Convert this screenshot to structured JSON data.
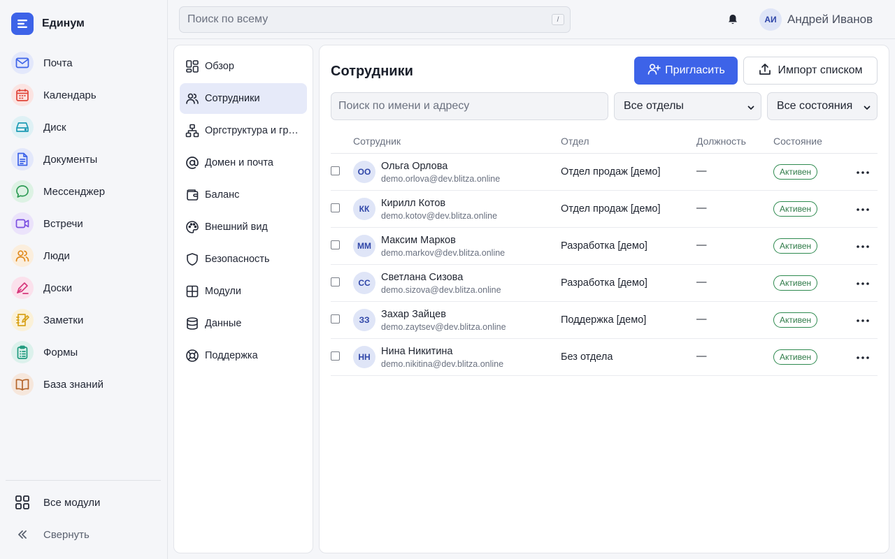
{
  "brand": {
    "name": "Единум"
  },
  "apps": [
    {
      "key": "mail",
      "label": "Почта",
      "icon": "mail-icon",
      "color": "#3d63e8",
      "bg": "#e3e8fb"
    },
    {
      "key": "calendar",
      "label": "Календарь",
      "icon": "calendar-icon",
      "color": "#e0453a",
      "bg": "#fbe4e2"
    },
    {
      "key": "disk",
      "label": "Диск",
      "icon": "drive-icon",
      "color": "#1e9bb5",
      "bg": "#dff1f5"
    },
    {
      "key": "docs",
      "label": "Документы",
      "icon": "document-icon",
      "color": "#3d63e8",
      "bg": "#e3e8fb"
    },
    {
      "key": "messenger",
      "label": "Мессенджер",
      "icon": "chat-icon",
      "color": "#2e9b55",
      "bg": "#ddf2e4"
    },
    {
      "key": "meetings",
      "label": "Встречи",
      "icon": "video-icon",
      "color": "#7b4fe0",
      "bg": "#ebe3fb"
    },
    {
      "key": "people",
      "label": "Люди",
      "icon": "people-icon",
      "color": "#e08a1e",
      "bg": "#fbeedd"
    },
    {
      "key": "boards",
      "label": "Доски",
      "icon": "pen-icon",
      "color": "#d6387c",
      "bg": "#fbe1ec"
    },
    {
      "key": "notes",
      "label": "Заметки",
      "icon": "note-icon",
      "color": "#d8a21a",
      "bg": "#fbf1d8"
    },
    {
      "key": "forms",
      "label": "Формы",
      "icon": "clipboard-icon",
      "color": "#1f9a7e",
      "bg": "#dcf1ec"
    },
    {
      "key": "kb",
      "label": "База знаний",
      "icon": "book-icon",
      "color": "#b5652a",
      "bg": "#f6e7dc"
    }
  ],
  "sidebar_bottom": {
    "all_modules": "Все модули",
    "collapse": "Свернуть"
  },
  "topbar": {
    "search_placeholder": "Поиск по всему",
    "search_shortcut": "/",
    "user_initials": "АИ",
    "user_name": "Андрей Иванов"
  },
  "settings_nav": [
    {
      "label": "Обзор",
      "icon": "overview-icon",
      "active": false
    },
    {
      "label": "Сотрудники",
      "icon": "users-icon",
      "active": true
    },
    {
      "label": "Оргструктура и группы",
      "icon": "org-structure-icon",
      "active": false
    },
    {
      "label": "Домен и почта",
      "icon": "at-icon",
      "active": false
    },
    {
      "label": "Баланс",
      "icon": "wallet-icon",
      "active": false
    },
    {
      "label": "Внешний вид",
      "icon": "palette-icon",
      "active": false
    },
    {
      "label": "Безопасность",
      "icon": "shield-icon",
      "active": false
    },
    {
      "label": "Модули",
      "icon": "modules-icon",
      "active": false
    },
    {
      "label": "Данные",
      "icon": "database-icon",
      "active": false
    },
    {
      "label": "Поддержка",
      "icon": "lifebuoy-icon",
      "active": false
    }
  ],
  "main": {
    "title": "Сотрудники",
    "invite_label": "Пригласить",
    "import_label": "Импорт списком",
    "filter_placeholder": "Поиск по имени и адресу",
    "dept_select": "Все отделы",
    "state_select": "Все состояния",
    "columns": {
      "employee": "Сотрудник",
      "dept": "Отдел",
      "position": "Должность",
      "state": "Состояние"
    },
    "rows": [
      {
        "initials": "ОО",
        "name": "Ольга Орлова",
        "email": "demo.orlova@dev.blitza.online",
        "dept": "Отдел продаж [демо]",
        "position": "—",
        "status": "Активен"
      },
      {
        "initials": "КК",
        "name": "Кирилл Котов",
        "email": "demo.kotov@dev.blitza.online",
        "dept": "Отдел продаж [демо]",
        "position": "—",
        "status": "Активен"
      },
      {
        "initials": "ММ",
        "name": "Максим Марков",
        "email": "demo.markov@dev.blitza.online",
        "dept": "Разработка [демо]",
        "position": "—",
        "status": "Активен"
      },
      {
        "initials": "СС",
        "name": "Светлана Сизова",
        "email": "demo.sizova@dev.blitza.online",
        "dept": "Разработка [демо]",
        "position": "—",
        "status": "Активен"
      },
      {
        "initials": "ЗЗ",
        "name": "Захар Зайцев",
        "email": "demo.zaytsev@dev.blitza.online",
        "dept": "Поддержка [демо]",
        "position": "—",
        "status": "Активен"
      },
      {
        "initials": "НН",
        "name": "Нина Никитина",
        "email": "demo.nikitina@dev.blitza.online",
        "dept": "Без отдела",
        "position": "—",
        "status": "Активен"
      }
    ]
  },
  "colors": {
    "accent": "#3d63e8",
    "status_active": "#2e8a4f",
    "active_nav_bg": "#e6eaf9"
  }
}
